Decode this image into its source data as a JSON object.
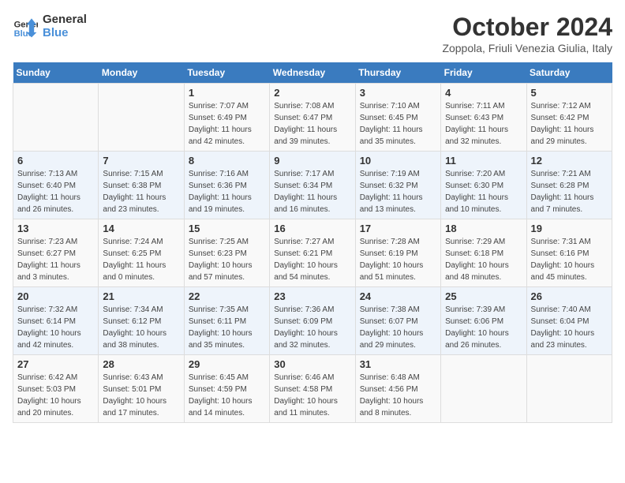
{
  "logo": {
    "line1": "General",
    "line2": "Blue"
  },
  "title": "October 2024",
  "subtitle": "Zoppola, Friuli Venezia Giulia, Italy",
  "days_of_week": [
    "Sunday",
    "Monday",
    "Tuesday",
    "Wednesday",
    "Thursday",
    "Friday",
    "Saturday"
  ],
  "weeks": [
    [
      {
        "day": "",
        "info": ""
      },
      {
        "day": "",
        "info": ""
      },
      {
        "day": "1",
        "info": "Sunrise: 7:07 AM\nSunset: 6:49 PM\nDaylight: 11 hours and 42 minutes."
      },
      {
        "day": "2",
        "info": "Sunrise: 7:08 AM\nSunset: 6:47 PM\nDaylight: 11 hours and 39 minutes."
      },
      {
        "day": "3",
        "info": "Sunrise: 7:10 AM\nSunset: 6:45 PM\nDaylight: 11 hours and 35 minutes."
      },
      {
        "day": "4",
        "info": "Sunrise: 7:11 AM\nSunset: 6:43 PM\nDaylight: 11 hours and 32 minutes."
      },
      {
        "day": "5",
        "info": "Sunrise: 7:12 AM\nSunset: 6:42 PM\nDaylight: 11 hours and 29 minutes."
      }
    ],
    [
      {
        "day": "6",
        "info": "Sunrise: 7:13 AM\nSunset: 6:40 PM\nDaylight: 11 hours and 26 minutes."
      },
      {
        "day": "7",
        "info": "Sunrise: 7:15 AM\nSunset: 6:38 PM\nDaylight: 11 hours and 23 minutes."
      },
      {
        "day": "8",
        "info": "Sunrise: 7:16 AM\nSunset: 6:36 PM\nDaylight: 11 hours and 19 minutes."
      },
      {
        "day": "9",
        "info": "Sunrise: 7:17 AM\nSunset: 6:34 PM\nDaylight: 11 hours and 16 minutes."
      },
      {
        "day": "10",
        "info": "Sunrise: 7:19 AM\nSunset: 6:32 PM\nDaylight: 11 hours and 13 minutes."
      },
      {
        "day": "11",
        "info": "Sunrise: 7:20 AM\nSunset: 6:30 PM\nDaylight: 11 hours and 10 minutes."
      },
      {
        "day": "12",
        "info": "Sunrise: 7:21 AM\nSunset: 6:28 PM\nDaylight: 11 hours and 7 minutes."
      }
    ],
    [
      {
        "day": "13",
        "info": "Sunrise: 7:23 AM\nSunset: 6:27 PM\nDaylight: 11 hours and 3 minutes."
      },
      {
        "day": "14",
        "info": "Sunrise: 7:24 AM\nSunset: 6:25 PM\nDaylight: 11 hours and 0 minutes."
      },
      {
        "day": "15",
        "info": "Sunrise: 7:25 AM\nSunset: 6:23 PM\nDaylight: 10 hours and 57 minutes."
      },
      {
        "day": "16",
        "info": "Sunrise: 7:27 AM\nSunset: 6:21 PM\nDaylight: 10 hours and 54 minutes."
      },
      {
        "day": "17",
        "info": "Sunrise: 7:28 AM\nSunset: 6:19 PM\nDaylight: 10 hours and 51 minutes."
      },
      {
        "day": "18",
        "info": "Sunrise: 7:29 AM\nSunset: 6:18 PM\nDaylight: 10 hours and 48 minutes."
      },
      {
        "day": "19",
        "info": "Sunrise: 7:31 AM\nSunset: 6:16 PM\nDaylight: 10 hours and 45 minutes."
      }
    ],
    [
      {
        "day": "20",
        "info": "Sunrise: 7:32 AM\nSunset: 6:14 PM\nDaylight: 10 hours and 42 minutes."
      },
      {
        "day": "21",
        "info": "Sunrise: 7:34 AM\nSunset: 6:12 PM\nDaylight: 10 hours and 38 minutes."
      },
      {
        "day": "22",
        "info": "Sunrise: 7:35 AM\nSunset: 6:11 PM\nDaylight: 10 hours and 35 minutes."
      },
      {
        "day": "23",
        "info": "Sunrise: 7:36 AM\nSunset: 6:09 PM\nDaylight: 10 hours and 32 minutes."
      },
      {
        "day": "24",
        "info": "Sunrise: 7:38 AM\nSunset: 6:07 PM\nDaylight: 10 hours and 29 minutes."
      },
      {
        "day": "25",
        "info": "Sunrise: 7:39 AM\nSunset: 6:06 PM\nDaylight: 10 hours and 26 minutes."
      },
      {
        "day": "26",
        "info": "Sunrise: 7:40 AM\nSunset: 6:04 PM\nDaylight: 10 hours and 23 minutes."
      }
    ],
    [
      {
        "day": "27",
        "info": "Sunrise: 6:42 AM\nSunset: 5:03 PM\nDaylight: 10 hours and 20 minutes."
      },
      {
        "day": "28",
        "info": "Sunrise: 6:43 AM\nSunset: 5:01 PM\nDaylight: 10 hours and 17 minutes."
      },
      {
        "day": "29",
        "info": "Sunrise: 6:45 AM\nSunset: 4:59 PM\nDaylight: 10 hours and 14 minutes."
      },
      {
        "day": "30",
        "info": "Sunrise: 6:46 AM\nSunset: 4:58 PM\nDaylight: 10 hours and 11 minutes."
      },
      {
        "day": "31",
        "info": "Sunrise: 6:48 AM\nSunset: 4:56 PM\nDaylight: 10 hours and 8 minutes."
      },
      {
        "day": "",
        "info": ""
      },
      {
        "day": "",
        "info": ""
      }
    ]
  ]
}
